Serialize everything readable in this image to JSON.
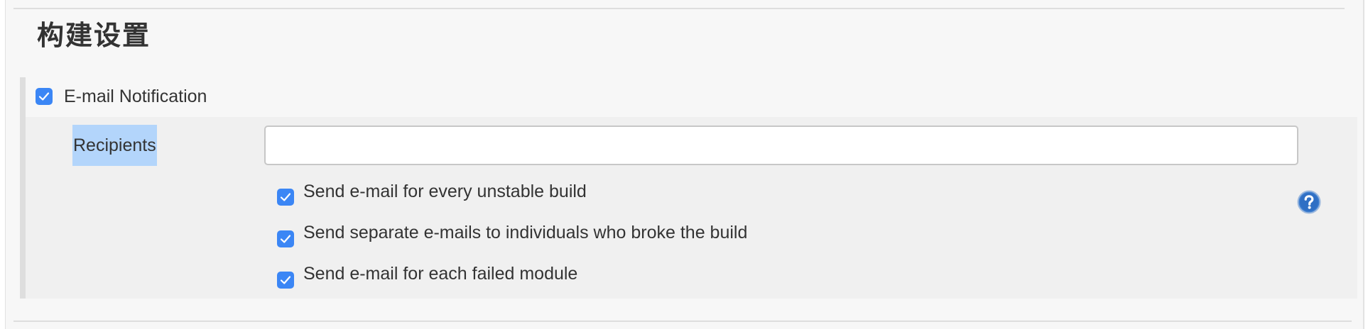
{
  "section": {
    "title": "构建设置"
  },
  "email_notification": {
    "label": "E-mail Notification",
    "checked": true,
    "recipients": {
      "label": "Recipients",
      "value": "",
      "placeholder": ""
    },
    "options": [
      {
        "label": "Send e-mail for every unstable build",
        "checked": true
      },
      {
        "label": "Send separate e-mails to individuals who broke the build",
        "checked": true
      },
      {
        "label": "Send e-mail for each failed module",
        "checked": true
      }
    ]
  },
  "icons": {
    "checkbox": "checkmark-icon",
    "help": "help-question-icon"
  },
  "colors": {
    "checkbox_fill": "#3b86f5",
    "selection_highlight": "#b3d5fb",
    "help_icon": "#3f7fd0"
  }
}
